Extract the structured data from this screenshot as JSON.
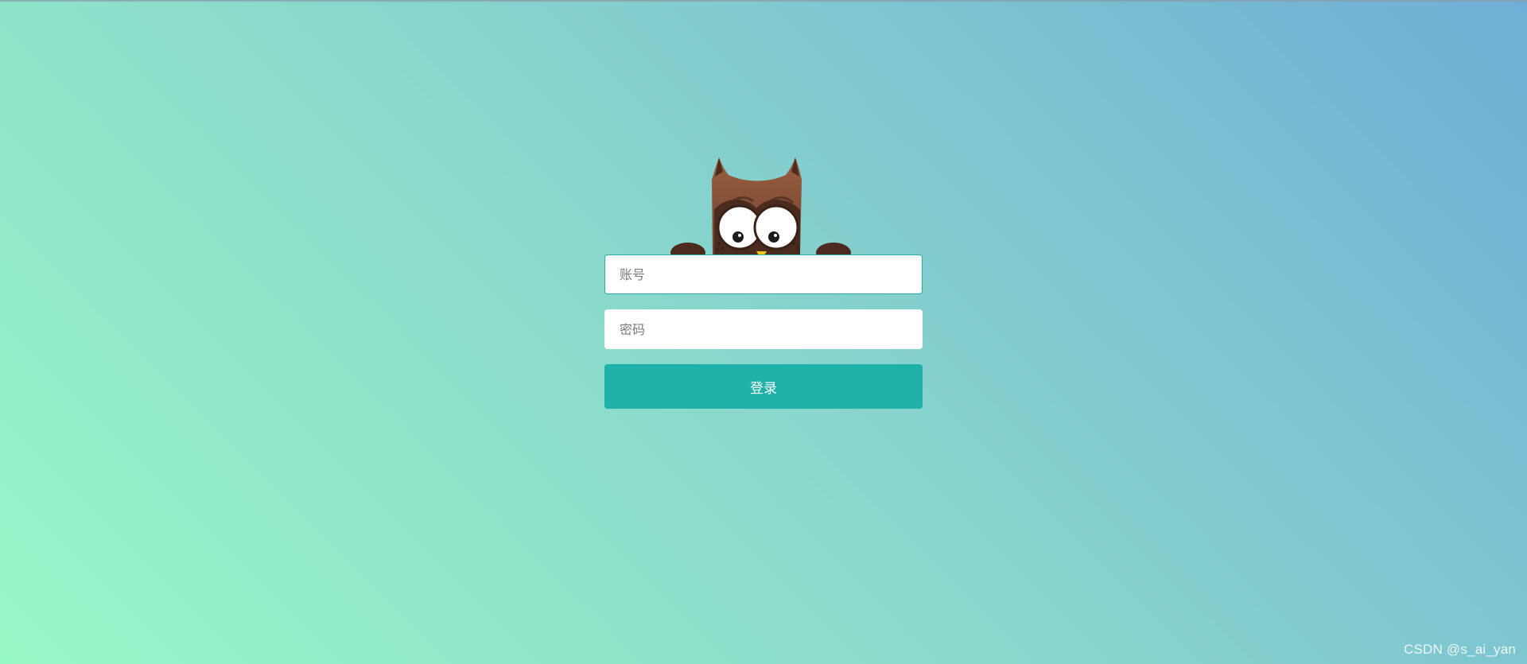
{
  "login": {
    "account_placeholder": "账号",
    "password_placeholder": "密码",
    "submit_label": "登录"
  },
  "mascot": {
    "icon": "owl-icon"
  },
  "watermark": {
    "text": "CSDN @s_ai_yan"
  }
}
